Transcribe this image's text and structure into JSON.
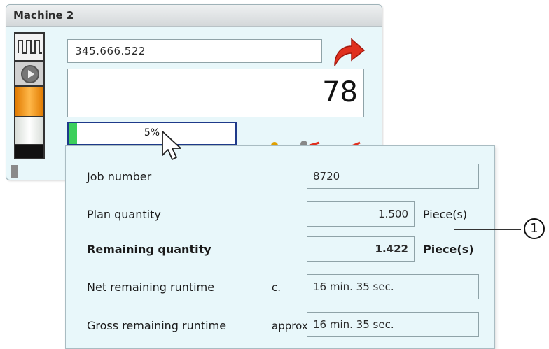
{
  "panel": {
    "title": "Machine 2",
    "serial": "345.666.522",
    "count": "78",
    "progress": {
      "value_pct": 5,
      "label": "5%"
    },
    "icons": [
      "pulse-icon",
      "play-icon",
      "redo-arrow-icon"
    ],
    "colors": {
      "accent_arrow": "#e0301e",
      "progress_fill": "#3ccf5c",
      "progress_border": "#1e3a8a",
      "panel_bg": "#e8f7fa"
    }
  },
  "tooltip": {
    "job_number": {
      "label": "Job number",
      "value": "8720"
    },
    "plan_quantity": {
      "label": "Plan quantity",
      "value": "1.500",
      "unit": "Piece(s)"
    },
    "remaining_quantity": {
      "label": "Remaining quantity",
      "value": "1.422",
      "unit": "Piece(s)"
    },
    "net_runtime": {
      "label": "Net remaining runtime",
      "prefix": "c.",
      "value": "16 min. 35 sec."
    },
    "gross_runtime": {
      "label": "Gross remaining runtime",
      "prefix": "approx.",
      "value": "16 min. 35 sec."
    }
  },
  "callout": {
    "number": "1"
  }
}
